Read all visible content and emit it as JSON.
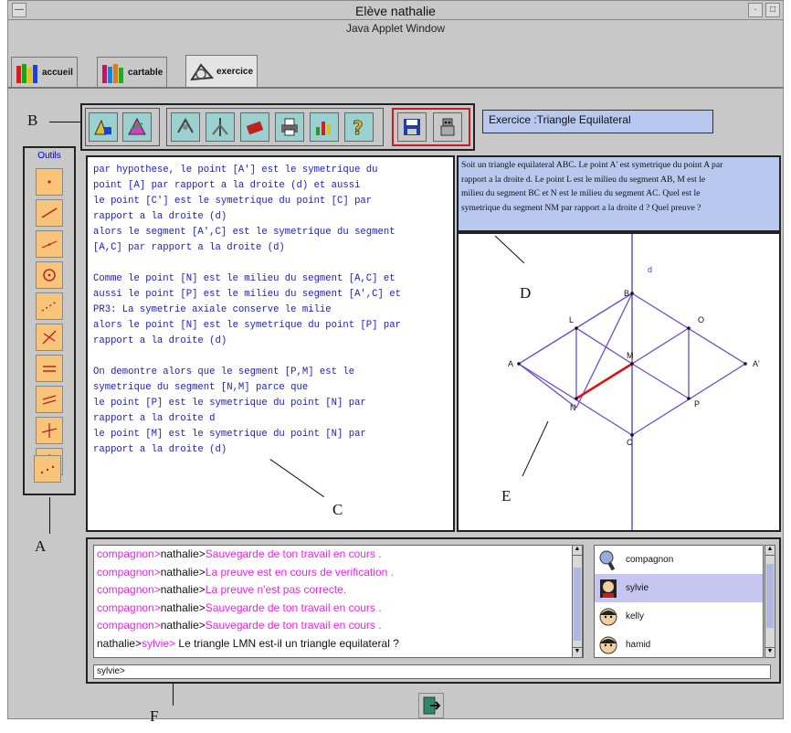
{
  "window": {
    "title": "Elève nathalie",
    "subtitle": "Java Applet Window"
  },
  "tabs": [
    {
      "label": "accueil"
    },
    {
      "label": "cartable"
    },
    {
      "label": "exercice",
      "active": true
    }
  ],
  "exercise_title": "Exercice :Triangle Equilateral",
  "tools_panel_label": "Outils",
  "tools": [
    "point-tool",
    "segment-tool",
    "line-tool",
    "circle-tool",
    "dotted-line-tool",
    "perpendicular-tool",
    "parallel-tool",
    "parallel-lines-tool",
    "cross-tool",
    "intersection-tool",
    "midpoint-tool"
  ],
  "proof_text": [
    "par hypothese, le point [A'] est le symetrique du",
    "point [A] par rapport a la droite (d) et aussi",
    "le point [C'] est le symetrique du point [C] par",
    "rapport a la droite (d)",
    "alors le segment [A',C] est le symetrique du segment",
    "[A,C] par rapport a la droite (d)",
    "",
    "Comme le point [N] est le milieu du segment [A,C] et",
    "aussi le point [P] est le milieu du segment [A',C] et",
    "PR3: La symetrie axiale conserve le milie",
    "alors le point [N] est le symetrique du point [P] par",
    "rapport a la droite (d)",
    "",
    "On demontre alors que le segment [P,M] est le",
    "symetrique du segment [N,M] parce que",
    "le point [P] est le symetrique du point [N] par",
    "rapport a la droite d",
    "le point [M] est le symetrique du point [N] par",
    "rapport a la droite (d)"
  ],
  "statement_lines": [
    "Soit un triangle equilateral ABC. Le point A' est symetrique du point A par",
    "rapport a la droite d. Le point L est le milieu du segment AB, M est le",
    "milieu du segment BC et N est le milieu du segment AC. Quel est le",
    "symetrique du segment NM par rapport a la droite d ? Quel preuve ?"
  ],
  "figure": {
    "points": [
      "d",
      "B",
      "L",
      "O",
      "A",
      "M",
      "A'",
      "N",
      "P",
      "C"
    ],
    "colors": {
      "lines": "#6a4fd0",
      "highlight": "#e01010",
      "axis": "#4a3ad0"
    }
  },
  "chat": {
    "messages": [
      {
        "from": "compagnon",
        "to": "nathalie",
        "text": "Sauvegarde de ton travail en cours ."
      },
      {
        "from": "compagnon",
        "to": "nathalie",
        "text": "La preuve est en cours de verification ."
      },
      {
        "from": "compagnon",
        "to": "nathalie",
        "text": "La preuve n'est pas correcte."
      },
      {
        "from": "compagnon",
        "to": "nathalie",
        "text": "Sauvegarde de ton travail en cours ."
      },
      {
        "from": "compagnon",
        "to": "nathalie",
        "text": "Sauvegarde de ton travail en cours ."
      },
      {
        "from": "nathalie",
        "to": "sylvie",
        "text": " Le triangle LMN est-il un triangle equilateral ?"
      }
    ],
    "users": [
      {
        "name": "compagnon",
        "selected": false
      },
      {
        "name": "sylvie",
        "selected": true
      },
      {
        "name": "kelly",
        "selected": false
      },
      {
        "name": "hamid",
        "selected": false
      }
    ],
    "input_value": "sylvie>"
  },
  "annotations": [
    "A",
    "B",
    "C",
    "D",
    "E",
    "F"
  ],
  "colors": {
    "pink": "#f020f0",
    "dark": "#111111",
    "blue_text": "#1a1acc",
    "panel_blue": "#b8c8ee"
  }
}
